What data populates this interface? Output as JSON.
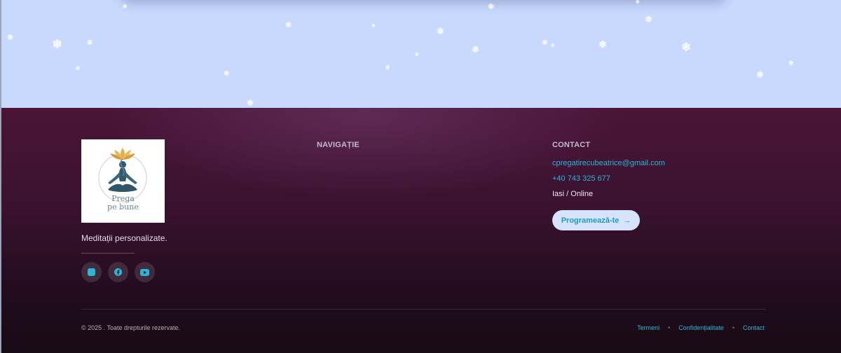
{
  "brand": {
    "logo_text_line1": "Prega",
    "logo_text_line2": "pe bune",
    "tagline": "Meditații personalizate."
  },
  "socials": [
    {
      "name": "instagram-icon"
    },
    {
      "name": "facebook-icon"
    },
    {
      "name": "youtube-icon"
    }
  ],
  "navigation": {
    "title": "NAVIGAȚIE"
  },
  "contact": {
    "title": "CONTACT",
    "email": "cpregatirecubeatrice@gmail.com",
    "phone": "+40 743 325 677",
    "location": "Iasi / Online",
    "cta_label": "Programează-te",
    "cta_arrow": "→"
  },
  "bottom": {
    "copyright": "© 2025 . Toate drepturile rezervate.",
    "links": [
      "Termeni",
      "Confidențialitate",
      "Contact"
    ],
    "separator": "•"
  },
  "colors": {
    "accent": "#2bb6d6",
    "footer_top": "#4a1537",
    "footer_bottom": "#170b14",
    "sky": "#c8d9fd"
  }
}
